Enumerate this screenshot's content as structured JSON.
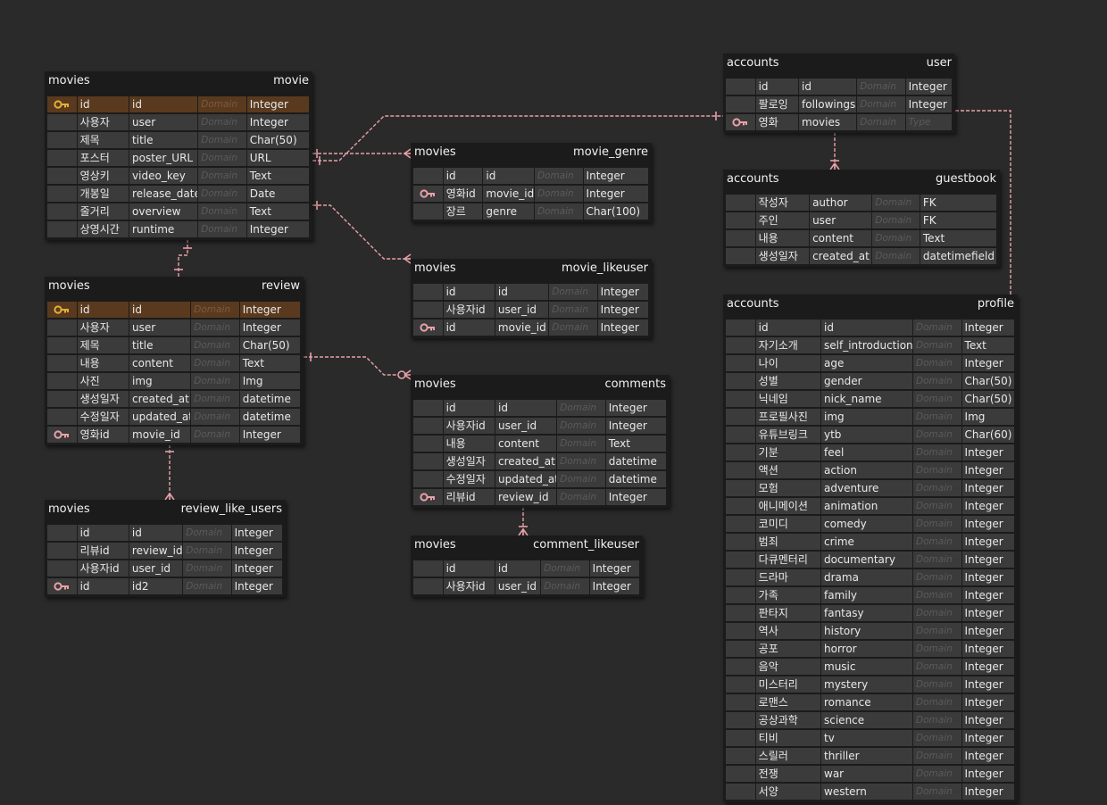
{
  "colors": {
    "background": "#2a2a2a",
    "table_background": "#1b1b1b",
    "cell_background": "#3b3b3b",
    "primary_key_row": "#5a3a1e",
    "relation_line": "#e8a0a8",
    "primary_key_icon": "#e2b03a",
    "foreign_key_icon": "#e8a0a8"
  },
  "tables": [
    {
      "id": "movies_movie",
      "schema": "movies",
      "name": "movie",
      "rows": [
        {
          "label": "id",
          "field": "id",
          "domain": "Domain",
          "type": "Integer",
          "key": "primary-key-icon"
        },
        {
          "label": "사용자",
          "field": "user",
          "domain": "Domain",
          "type": "Integer",
          "key": ""
        },
        {
          "label": "제목",
          "field": "title",
          "domain": "Domain",
          "type": "Char(50)",
          "key": ""
        },
        {
          "label": "포스터",
          "field": "poster_URL",
          "domain": "Domain",
          "type": "URL",
          "key": ""
        },
        {
          "label": "영상키",
          "field": "video_key",
          "domain": "Domain",
          "type": "Text",
          "key": ""
        },
        {
          "label": "개봉일",
          "field": "release_date",
          "domain": "Domain",
          "type": "Date",
          "key": ""
        },
        {
          "label": "줄거리",
          "field": "overview",
          "domain": "Domain",
          "type": "Text",
          "key": ""
        },
        {
          "label": "상영시간",
          "field": "runtime",
          "domain": "Domain",
          "type": "Integer",
          "key": ""
        }
      ]
    },
    {
      "id": "movies_review",
      "schema": "movies",
      "name": "review",
      "rows": [
        {
          "label": "id",
          "field": "id",
          "domain": "Domain",
          "type": "Integer",
          "key": "primary-key-icon"
        },
        {
          "label": "사용자",
          "field": "user",
          "domain": "Domain",
          "type": "Integer",
          "key": ""
        },
        {
          "label": "제목",
          "field": "title",
          "domain": "Domain",
          "type": "Char(50)",
          "key": ""
        },
        {
          "label": "내용",
          "field": "content",
          "domain": "Domain",
          "type": "Text",
          "key": ""
        },
        {
          "label": "사진",
          "field": "img",
          "domain": "Domain",
          "type": "Img",
          "key": ""
        },
        {
          "label": "생성일자",
          "field": "created_at",
          "domain": "Domain",
          "type": "datetime",
          "key": ""
        },
        {
          "label": "수정일자",
          "field": "updated_at",
          "domain": "Domain",
          "type": "datetime",
          "key": ""
        },
        {
          "label": "영화id",
          "field": "movie_id",
          "domain": "Domain",
          "type": "Integer",
          "key": "foreign-key-icon"
        }
      ]
    },
    {
      "id": "movies_review_like_users",
      "schema": "movies",
      "name": "review_like_users",
      "rows": [
        {
          "label": "id",
          "field": "id",
          "domain": "Domain",
          "type": "Integer",
          "key": ""
        },
        {
          "label": "리뷰id",
          "field": "review_id",
          "domain": "Domain",
          "type": "Integer",
          "key": ""
        },
        {
          "label": "사용자id",
          "field": "user_id",
          "domain": "Domain",
          "type": "Integer",
          "key": ""
        },
        {
          "label": "id",
          "field": "id2",
          "domain": "Domain",
          "type": "Integer",
          "key": "foreign-key-icon"
        }
      ]
    },
    {
      "id": "movies_movie_genre",
      "schema": "movies",
      "name": "movie_genre",
      "rows": [
        {
          "label": "id",
          "field": "id",
          "domain": "Domain",
          "type": "Integer",
          "key": ""
        },
        {
          "label": "영화id",
          "field": "movie_id",
          "domain": "Domain",
          "type": "Integer",
          "key": "foreign-key-icon"
        },
        {
          "label": "장르",
          "field": "genre",
          "domain": "Domain",
          "type": "Char(100)",
          "key": ""
        }
      ]
    },
    {
      "id": "movies_movie_likeuser",
      "schema": "movies",
      "name": "movie_likeuser",
      "rows": [
        {
          "label": "id",
          "field": "id",
          "domain": "Domain",
          "type": "Integer",
          "key": ""
        },
        {
          "label": "사용자id",
          "field": "user_id",
          "domain": "Domain",
          "type": "Integer",
          "key": ""
        },
        {
          "label": "id",
          "field": "movie_id",
          "domain": "Domain",
          "type": "Integer",
          "key": "foreign-key-icon"
        }
      ]
    },
    {
      "id": "movies_comments",
      "schema": "movies",
      "name": "comments",
      "rows": [
        {
          "label": "id",
          "field": "id",
          "domain": "Domain",
          "type": "Integer",
          "key": ""
        },
        {
          "label": "사용자id",
          "field": "user_id",
          "domain": "Domain",
          "type": "Integer",
          "key": ""
        },
        {
          "label": "내용",
          "field": "content",
          "domain": "Domain",
          "type": "Text",
          "key": ""
        },
        {
          "label": "생성일자",
          "field": "created_at",
          "domain": "Domain",
          "type": "datetime",
          "key": ""
        },
        {
          "label": "수정일자",
          "field": "updated_at",
          "domain": "Domain",
          "type": "datetime",
          "key": ""
        },
        {
          "label": "리뷰id",
          "field": "review_id",
          "domain": "Domain",
          "type": "Integer",
          "key": "foreign-key-icon"
        }
      ]
    },
    {
      "id": "movies_comment_likeuser",
      "schema": "movies",
      "name": "comment_likeuser",
      "rows": [
        {
          "label": "id",
          "field": "id",
          "domain": "Domain",
          "type": "Integer",
          "key": ""
        },
        {
          "label": "사용자id",
          "field": "user_id",
          "domain": "Domain",
          "type": "Integer",
          "key": ""
        }
      ]
    },
    {
      "id": "accounts_user",
      "schema": "accounts",
      "name": "user",
      "rows": [
        {
          "label": "id",
          "field": "id",
          "domain": "Domain",
          "type": "Integer",
          "key": ""
        },
        {
          "label": "팔로잉",
          "field": "followings",
          "domain": "Domain",
          "type": "Integer",
          "key": ""
        },
        {
          "label": "영화",
          "field": "movies",
          "domain": "Domain",
          "type": "Type",
          "key": "foreign-key-icon"
        }
      ]
    },
    {
      "id": "accounts_guestbook",
      "schema": "accounts",
      "name": "guestbook",
      "rows": [
        {
          "label": "작성자",
          "field": "author",
          "domain": "Domain",
          "type": "FK",
          "key": ""
        },
        {
          "label": "주인",
          "field": "user",
          "domain": "Domain",
          "type": "FK",
          "key": ""
        },
        {
          "label": "내용",
          "field": "content",
          "domain": "Domain",
          "type": "Text",
          "key": ""
        },
        {
          "label": "생성일자",
          "field": "created_at",
          "domain": "Domain",
          "type": "datetimefield",
          "key": ""
        }
      ]
    },
    {
      "id": "accounts_profile",
      "schema": "accounts",
      "name": "profile",
      "rows": [
        {
          "label": "id",
          "field": "id",
          "domain": "Domain",
          "type": "Integer",
          "key": ""
        },
        {
          "label": "자기소개",
          "field": "self_introduction",
          "domain": "Domain",
          "type": "Text",
          "key": ""
        },
        {
          "label": "나이",
          "field": "age",
          "domain": "Domain",
          "type": "Integer",
          "key": ""
        },
        {
          "label": "성별",
          "field": "gender",
          "domain": "Domain",
          "type": "Char(50)",
          "key": ""
        },
        {
          "label": "닉네임",
          "field": "nick_name",
          "domain": "Domain",
          "type": "Char(50)",
          "key": ""
        },
        {
          "label": "프로필사진",
          "field": "img",
          "domain": "Domain",
          "type": "Img",
          "key": ""
        },
        {
          "label": "유튜브링크",
          "field": "ytb",
          "domain": "Domain",
          "type": "Char(60)",
          "key": ""
        },
        {
          "label": "기분",
          "field": "feel",
          "domain": "Domain",
          "type": "Integer",
          "key": ""
        },
        {
          "label": "액션",
          "field": "action",
          "domain": "Domain",
          "type": "Integer",
          "key": ""
        },
        {
          "label": "모험",
          "field": "adventure",
          "domain": "Domain",
          "type": "Integer",
          "key": ""
        },
        {
          "label": "애니메이션",
          "field": "animation",
          "domain": "Domain",
          "type": "Integer",
          "key": ""
        },
        {
          "label": "코미디",
          "field": "comedy",
          "domain": "Domain",
          "type": "Integer",
          "key": ""
        },
        {
          "label": "범죄",
          "field": "crime",
          "domain": "Domain",
          "type": "Integer",
          "key": ""
        },
        {
          "label": "다큐멘터리",
          "field": "documentary",
          "domain": "Domain",
          "type": "Integer",
          "key": ""
        },
        {
          "label": "드라마",
          "field": "drama",
          "domain": "Domain",
          "type": "Integer",
          "key": ""
        },
        {
          "label": "가족",
          "field": "family",
          "domain": "Domain",
          "type": "Integer",
          "key": ""
        },
        {
          "label": "판타지",
          "field": "fantasy",
          "domain": "Domain",
          "type": "Integer",
          "key": ""
        },
        {
          "label": "역사",
          "field": "history",
          "domain": "Domain",
          "type": "Integer",
          "key": ""
        },
        {
          "label": "공포",
          "field": "horror",
          "domain": "Domain",
          "type": "Integer",
          "key": ""
        },
        {
          "label": "음악",
          "field": "music",
          "domain": "Domain",
          "type": "Integer",
          "key": ""
        },
        {
          "label": "미스터리",
          "field": "mystery",
          "domain": "Domain",
          "type": "Integer",
          "key": ""
        },
        {
          "label": "로맨스",
          "field": "romance",
          "domain": "Domain",
          "type": "Integer",
          "key": ""
        },
        {
          "label": "공상과학",
          "field": "science",
          "domain": "Domain",
          "type": "Integer",
          "key": ""
        },
        {
          "label": "티비",
          "field": "tv",
          "domain": "Domain",
          "type": "Integer",
          "key": ""
        },
        {
          "label": "스릴러",
          "field": "thriller",
          "domain": "Domain",
          "type": "Integer",
          "key": ""
        },
        {
          "label": "전쟁",
          "field": "war",
          "domain": "Domain",
          "type": "Integer",
          "key": ""
        },
        {
          "label": "서양",
          "field": "western",
          "domain": "Domain",
          "type": "Integer",
          "key": ""
        }
      ]
    }
  ],
  "relations": [
    {
      "from": "movies_movie",
      "to": "movies_review",
      "end": "one"
    },
    {
      "from": "movies_movie",
      "to": "movies_movie_genre",
      "end": "many"
    },
    {
      "from": "movies_movie",
      "to": "movies_movie_likeuser",
      "end": "many"
    },
    {
      "from": "movies_movie",
      "to": "accounts_user",
      "end": "one"
    },
    {
      "from": "movies_review",
      "to": "movies_comments",
      "end": "zero-or-many"
    },
    {
      "from": "movies_review",
      "to": "movies_review_like_users",
      "end": "many"
    },
    {
      "from": "movies_comments",
      "to": "movies_comment_likeuser",
      "end": "one-or-many"
    },
    {
      "from": "accounts_user",
      "to": "accounts_guestbook",
      "end": "one-or-many"
    },
    {
      "from": "accounts_user",
      "to": "accounts_profile",
      "end": "one"
    }
  ]
}
